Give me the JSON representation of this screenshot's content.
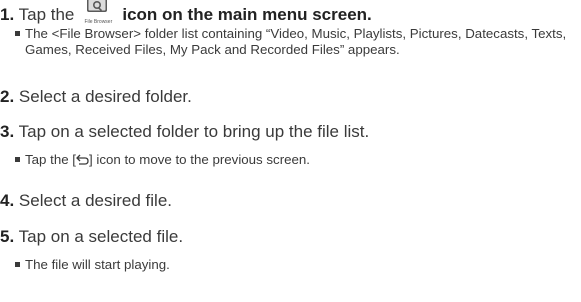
{
  "steps": [
    {
      "number": "1.",
      "text_before": "Tap the",
      "icon_caption": "File Browser",
      "icon_name": "file-browser-icon",
      "text_after": "icon on the main menu screen.",
      "bullets": [
        "The <File Browser> folder list containing “Video, Music, Playlists, Pictures, Datecasts, Texts, Games, Received Files, My Pack and Recorded Files” appears."
      ]
    },
    {
      "number": "2.",
      "text": "Select a desired folder."
    },
    {
      "number": "3.",
      "text": "Tap on a selected folder to bring up the file list.",
      "bullet_prefix": "Tap the [",
      "bullet_icon_name": "back-icon",
      "bullet_suffix": "] icon to move to the previous screen."
    },
    {
      "number": "4.",
      "text": "Select a desired file."
    },
    {
      "number": "5.",
      "text": "Tap on a selected file.",
      "bullets": [
        "The file will start playing."
      ]
    }
  ]
}
